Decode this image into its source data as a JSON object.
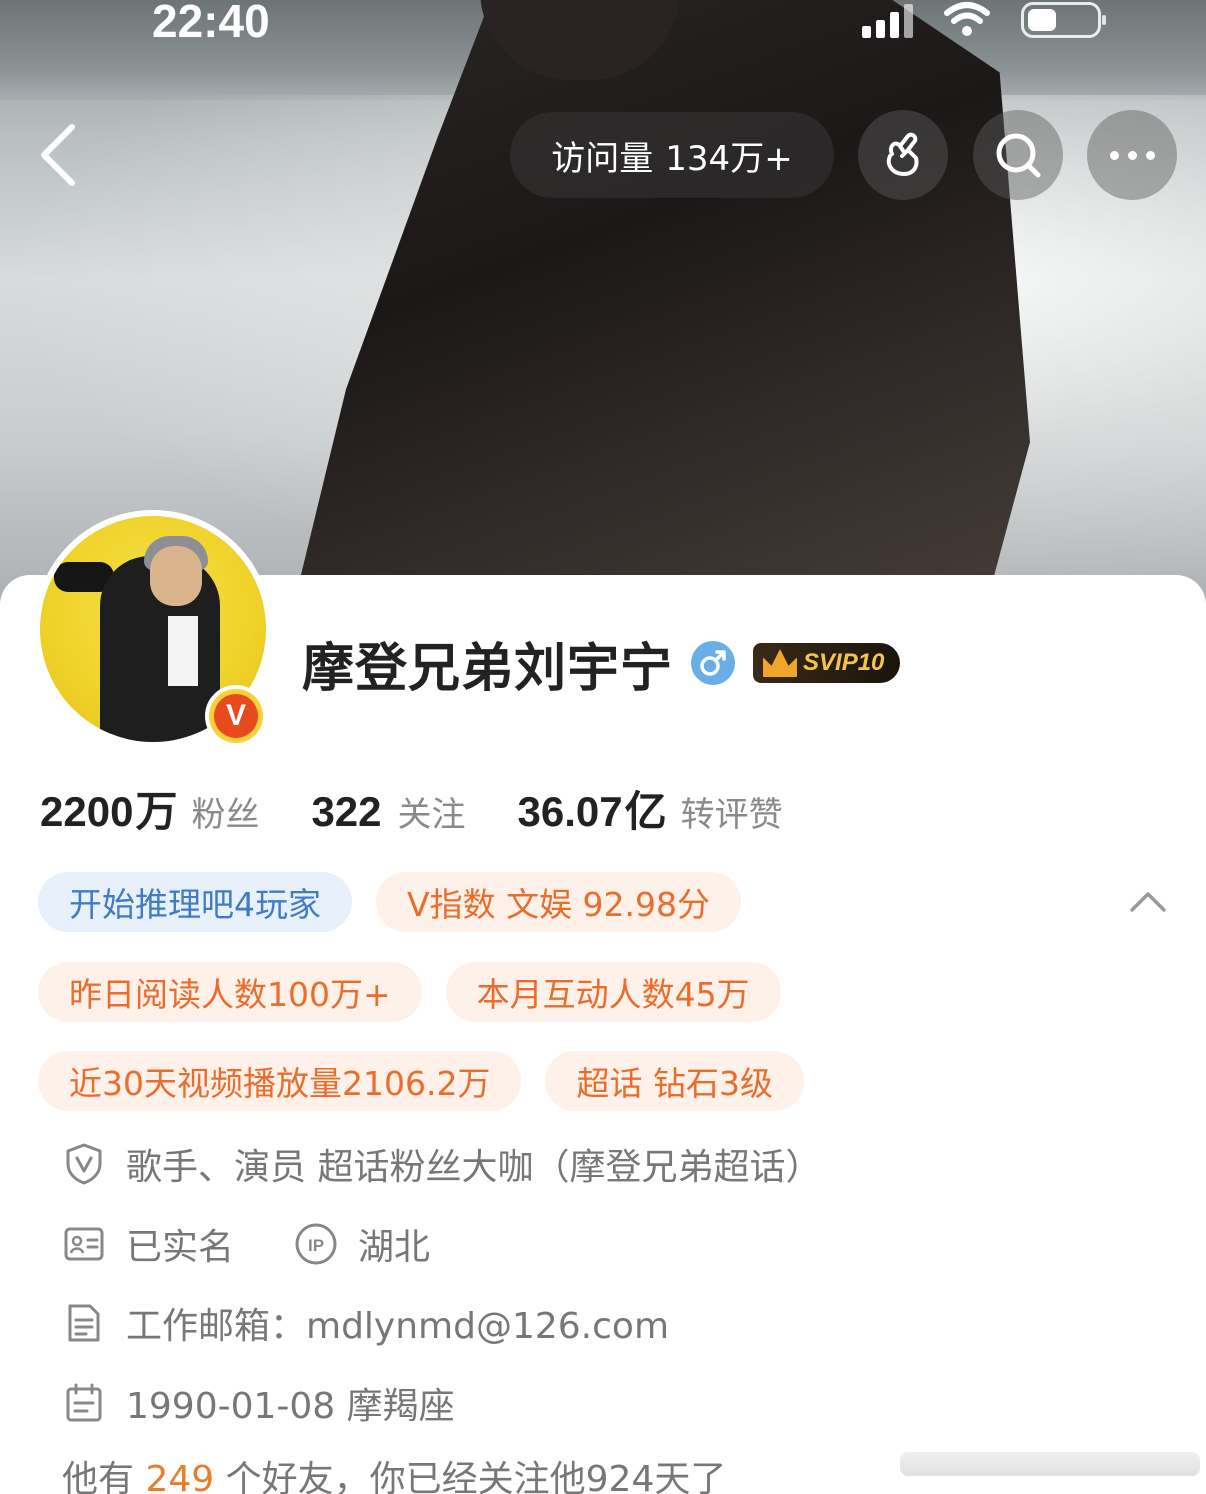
{
  "status_bar": {
    "time": "22:40"
  },
  "header": {
    "visit_label": "访问量",
    "visit_count": "134万+"
  },
  "profile": {
    "name": "摩登兄弟刘宇宁",
    "verified_mark": "V",
    "vip_badge": "SVIP10"
  },
  "stats": [
    {
      "num": "2200",
      "unit": "万",
      "label": "粉丝"
    },
    {
      "num": "322",
      "unit": "",
      "label": "关注"
    },
    {
      "num": "36.07",
      "unit": "亿",
      "label": "转评赞"
    }
  ],
  "tags": {
    "row1": [
      "开始推理吧4玩家",
      "V指数 文娱 92.98分"
    ],
    "row2": [
      "昨日阅读人数100万+",
      "本月互动人数45万"
    ],
    "row3": [
      "近30天视频播放量2106.2万",
      "超话 钻石3级"
    ]
  },
  "info": {
    "verification": "歌手、演员 超话粉丝大咖（摩登兄弟超话）",
    "real_name": "已实名",
    "ip_location": "湖北",
    "email": "工作邮箱：mdlynmd@126.com",
    "birthday": "1990-01-08 摩羯座"
  },
  "friends": {
    "prefix": "他有",
    "count": "249",
    "middle": "个好友，你已经关注他",
    "days": "924",
    "suffix": "天了"
  },
  "colors": {
    "tag_blue_text": "#3f7cc4",
    "tag_blue_bg": "#e8f1fb",
    "tag_orange_text": "#ea6d2c",
    "tag_orange_bg": "#fdf1ea",
    "gender_blue": "#6aaee8",
    "verified_badge": "#e8491d"
  }
}
